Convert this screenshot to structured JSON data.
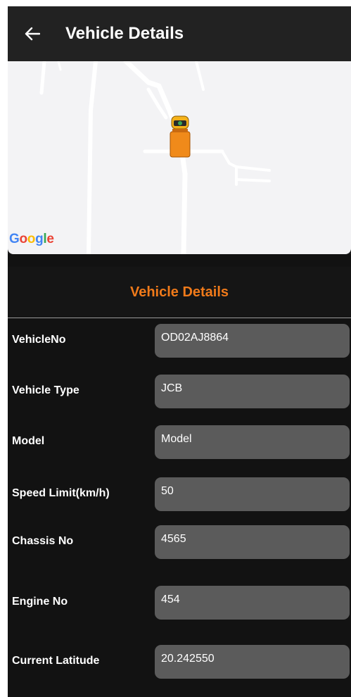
{
  "header": {
    "title": "Vehicle Details"
  },
  "map": {
    "attribution": {
      "letters": [
        "G",
        "o",
        "o",
        "g",
        "l",
        "e"
      ],
      "colors": [
        "#4285F4",
        "#EA4335",
        "#FBBC05",
        "#4285F4",
        "#34A853",
        "#EA4335"
      ]
    },
    "marker_icon": "truck-icon"
  },
  "details": {
    "title": "Vehicle Details",
    "title_color": "#f07a1a",
    "rows": [
      {
        "label": "VehicleNo",
        "value": "OD02AJ8864"
      },
      {
        "label": "Vehicle Type",
        "value": "JCB"
      },
      {
        "label": "Model",
        "value": "Model"
      },
      {
        "label": "Speed Limit(km/h)",
        "value": "50"
      },
      {
        "label": "Chassis No",
        "value": "4565"
      },
      {
        "label": "Engine No",
        "value": "454"
      },
      {
        "label": "Current Latitude",
        "value": "20.242550"
      }
    ]
  }
}
